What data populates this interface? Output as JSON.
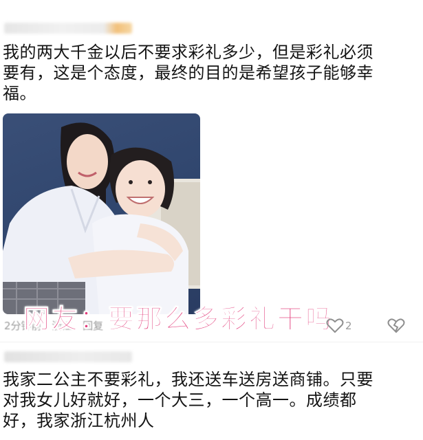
{
  "posts": [
    {
      "text": "我的两大千金以后不要求彩礼多少，但是彩礼必须\n要有，这是个态度，最终的目的是希望孩子能够幸\n福。",
      "meta": {
        "time": "2分钟前",
        "location": "浙江",
        "extra": "回复"
      },
      "like_count": "2"
    },
    {
      "text": "我家二公主不要彩礼，我还送车送房送商铺。只要\n对我女儿好就好，一个大三，一个高一。成绩都\n好，我家浙江杭州人"
    }
  ],
  "overlay_caption": "网友：要那么多彩礼干吗",
  "icons": {
    "like": "heart-outline-icon",
    "dislike": "broken-heart-icon"
  },
  "colors": {
    "caption": "#e23b7a",
    "meta": "#9a9a9a"
  }
}
